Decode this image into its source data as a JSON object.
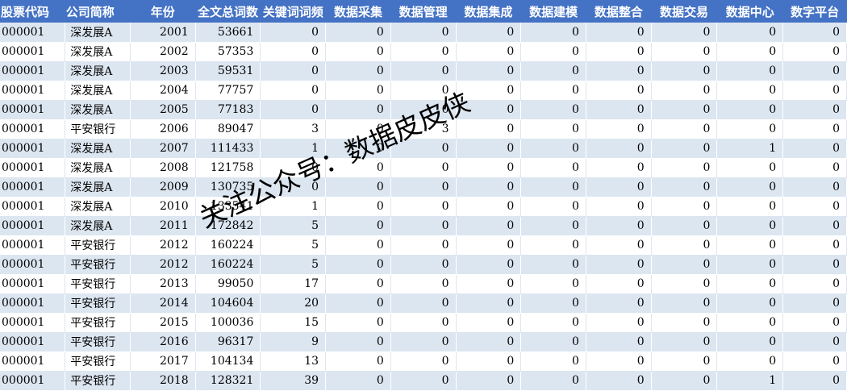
{
  "columns": [
    "股票代码",
    "公司简称",
    "年份",
    "全文总词数",
    "关键词词频",
    "数据采集",
    "数据管理",
    "数据集成",
    "数据建模",
    "数据整合",
    "数据交易",
    "数据中心",
    "数字平台"
  ],
  "rows": [
    [
      "000001",
      "深发展A",
      "2001",
      "53661",
      "0",
      "0",
      "0",
      "0",
      "0",
      "0",
      "0",
      "0",
      "0"
    ],
    [
      "000001",
      "深发展A",
      "2002",
      "57353",
      "0",
      "0",
      "0",
      "0",
      "0",
      "0",
      "0",
      "0",
      "0"
    ],
    [
      "000001",
      "深发展A",
      "2003",
      "59531",
      "0",
      "0",
      "0",
      "0",
      "0",
      "0",
      "0",
      "0",
      "0"
    ],
    [
      "000001",
      "深发展A",
      "2004",
      "77757",
      "0",
      "0",
      "0",
      "0",
      "0",
      "0",
      "0",
      "0",
      "0"
    ],
    [
      "000001",
      "深发展A",
      "2005",
      "77183",
      "0",
      "0",
      "0",
      "0",
      "0",
      "0",
      "0",
      "0",
      "0"
    ],
    [
      "000001",
      "平安银行",
      "2006",
      "89047",
      "3",
      "0",
      "3",
      "0",
      "0",
      "0",
      "0",
      "0",
      "0"
    ],
    [
      "000001",
      "深发展A",
      "2007",
      "111433",
      "1",
      "0",
      "0",
      "0",
      "0",
      "0",
      "0",
      "1",
      "0"
    ],
    [
      "000001",
      "深发展A",
      "2008",
      "121758",
      "0",
      "0",
      "0",
      "0",
      "0",
      "0",
      "0",
      "0",
      "0"
    ],
    [
      "000001",
      "深发展A",
      "2009",
      "130735",
      "0",
      "0",
      "0",
      "0",
      "0",
      "0",
      "0",
      "0",
      "0"
    ],
    [
      "000001",
      "深发展A",
      "2010",
      "133541",
      "1",
      "0",
      "0",
      "0",
      "0",
      "0",
      "0",
      "0",
      "0"
    ],
    [
      "000001",
      "深发展A",
      "2011",
      "172842",
      "5",
      "0",
      "0",
      "0",
      "0",
      "0",
      "0",
      "0",
      "0"
    ],
    [
      "000001",
      "平安银行",
      "2012",
      "160224",
      "5",
      "0",
      "0",
      "0",
      "0",
      "0",
      "0",
      "0",
      "0"
    ],
    [
      "000001",
      "平安银行",
      "2012",
      "160224",
      "5",
      "0",
      "0",
      "0",
      "0",
      "0",
      "0",
      "0",
      "0"
    ],
    [
      "000001",
      "平安银行",
      "2013",
      "99050",
      "17",
      "0",
      "0",
      "0",
      "0",
      "0",
      "0",
      "0",
      "0"
    ],
    [
      "000001",
      "平安银行",
      "2014",
      "104604",
      "20",
      "0",
      "0",
      "0",
      "0",
      "0",
      "0",
      "0",
      "0"
    ],
    [
      "000001",
      "平安银行",
      "2015",
      "100036",
      "15",
      "0",
      "0",
      "0",
      "0",
      "0",
      "0",
      "0",
      "0"
    ],
    [
      "000001",
      "平安银行",
      "2016",
      "96317",
      "9",
      "0",
      "0",
      "0",
      "0",
      "0",
      "0",
      "0",
      "0"
    ],
    [
      "000001",
      "平安银行",
      "2017",
      "104134",
      "13",
      "0",
      "0",
      "0",
      "0",
      "0",
      "0",
      "0",
      "0"
    ],
    [
      "000001",
      "平安银行",
      "2018",
      "128321",
      "39",
      "0",
      "0",
      "0",
      "0",
      "0",
      "0",
      "1",
      "0"
    ]
  ],
  "watermark": "关注公众号：数据皮皮侠",
  "colors": {
    "header_bg": "#4472c4",
    "header_text": "#ffffff",
    "band": "#dce6f1"
  }
}
